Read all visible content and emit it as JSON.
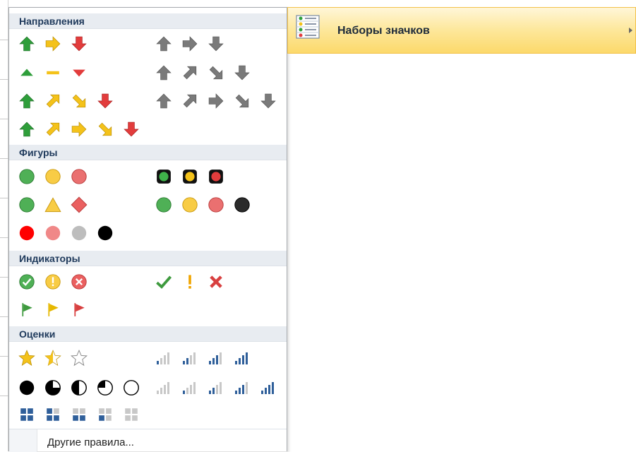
{
  "sections": {
    "directions": "Направления",
    "shapes": "Фигуры",
    "indicators": "Индикаторы",
    "ratings": "Оценки"
  },
  "submenu": {
    "label": "Наборы значков",
    "icon": "icon-sets-icon"
  },
  "footer": {
    "more_rules": "Другие правила..."
  },
  "colors": {
    "green": "#2e9e3a",
    "yellow": "#f4c21a",
    "red": "#e23c3c",
    "gray": "#7a7a7a",
    "header_bg": "#e8ecf1",
    "header_text": "#1e395b",
    "highlight": "#fde79a",
    "bar_blue": "#2f5f9a"
  }
}
